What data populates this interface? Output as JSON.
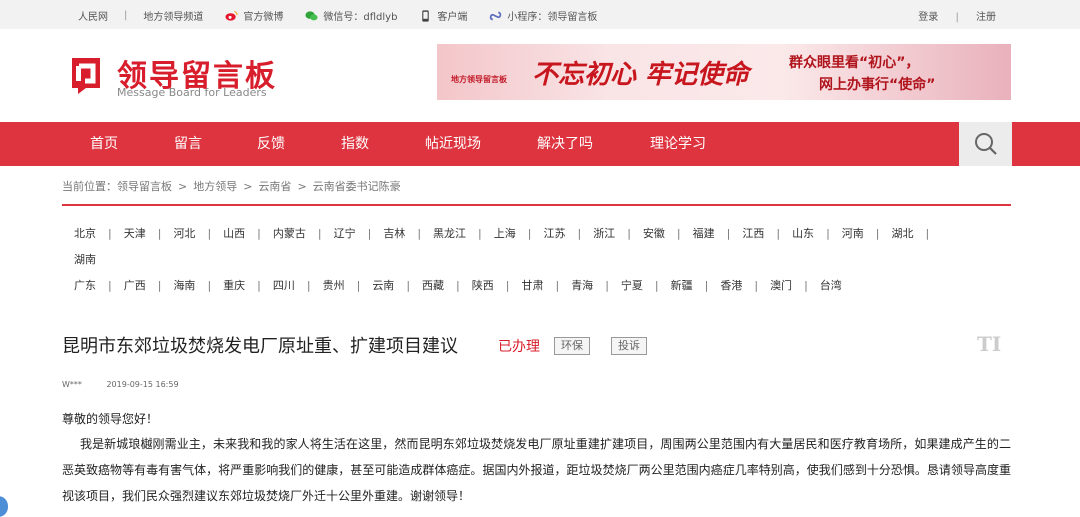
{
  "topbar": {
    "links": [
      "人民网",
      "地方领导频道"
    ],
    "weibo": "官方微博",
    "wechat": "微信号：dfldlyb",
    "client": "客户端",
    "miniprogram": "小程序：领导留言板",
    "login": "登录",
    "register": "注册",
    "sep": "|"
  },
  "header": {
    "logo_cn": "领导留言板",
    "logo_en": "Message Board for Leaders",
    "banner": {
      "logo_text": "地方领导留言板",
      "slogan1": "不忘初心 牢记使命",
      "slogan2": "群众眼里看“初心”，",
      "slogan3": "网上办事行“使命”"
    }
  },
  "nav": [
    "首页",
    "留言",
    "反馈",
    "指数",
    "帖近现场",
    "解决了吗",
    "理论学习"
  ],
  "breadcrumb": {
    "prefix": "当前位置：",
    "items": [
      "领导留言板",
      "地方领导",
      "云南省",
      "云南省委书记陈豪"
    ],
    "sep": ">"
  },
  "regions": {
    "row1": [
      "北京",
      "天津",
      "河北",
      "山西",
      "内蒙古",
      "辽宁",
      "吉林",
      "黑龙江",
      "上海",
      "江苏",
      "浙江",
      "安徽",
      "福建",
      "江西",
      "山东",
      "河南",
      "湖北"
    ],
    "row2": [
      "湖南"
    ],
    "row3": [
      "广东",
      "广西",
      "海南",
      "重庆",
      "四川",
      "贵州",
      "云南",
      "西藏",
      "陕西",
      "甘肃",
      "青海",
      "宁夏",
      "新疆",
      "香港",
      "澳门",
      "台湾"
    ]
  },
  "post": {
    "title": "昆明市东郊垃圾焚烧发电厂原址重、扩建项目建议",
    "status": "已办理",
    "tags": [
      "环保",
      "投诉"
    ],
    "font_toggle": "TI",
    "author": "W***",
    "time": "2019-09-15 16:59",
    "greeting": "尊敬的领导您好！",
    "body": "我是新城琅樾刚需业主，未来我和我的家人将生活在这里，然而昆明东郊垃圾焚烧发电厂原址重建扩建项目，周围两公里范围内有大量居民和医疗教育场所，如果建成产生的二恶英致癌物等有毒有害气体，将严重影响我们的健康，甚至可能造成群体癌症。据国内外报道，距垃圾焚烧厂两公里范围内癌症几率特别高，使我们感到十分恐惧。恳请领导高度重视该项目，我们民众强烈建议东郊垃圾焚烧厂外迁十公里外重建。谢谢领导！"
  },
  "colors": {
    "brand_red": "#dd3440",
    "status_red": "#d81e2c"
  }
}
